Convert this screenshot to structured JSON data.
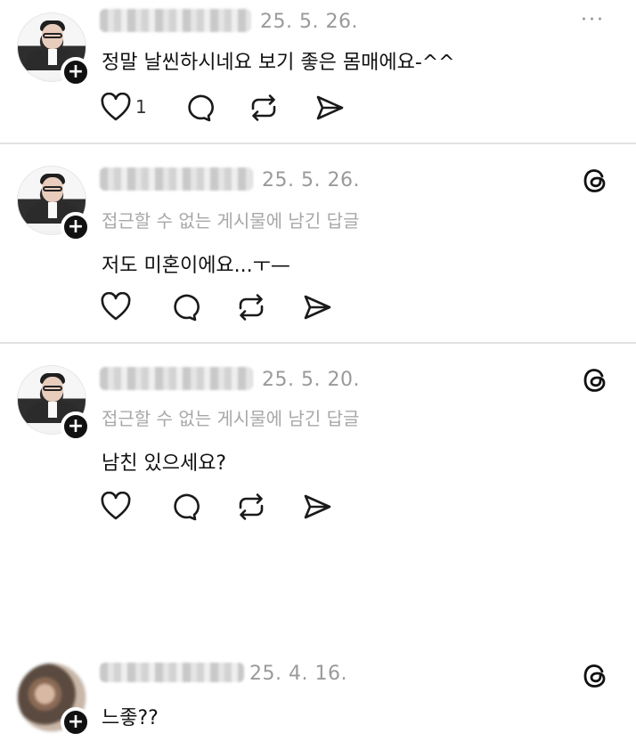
{
  "menu_glyph": "···",
  "posts": [
    {
      "date": "25. 5. 26.",
      "text": "정말 날씬하시네요 보기 좋은 몸매에요-^^",
      "like_count": "1"
    },
    {
      "date": "25. 5. 26.",
      "subtitle": "접근할 수 없는 게시물에 남긴 답글",
      "text": "저도 미혼이에요...ㅜ—"
    },
    {
      "date": "25. 5. 20.",
      "subtitle": "접근할 수 없는 게시물에 남긴 답글",
      "text": "남친 있으세요?"
    },
    {
      "date": "25. 4. 16.",
      "text": "느좋??"
    }
  ],
  "icons": {
    "like": "heart-icon",
    "comment": "comment-bubble-icon",
    "repost": "repost-icon",
    "share": "send-icon",
    "threads": "threads-logo-icon",
    "follow": "plus-icon"
  }
}
